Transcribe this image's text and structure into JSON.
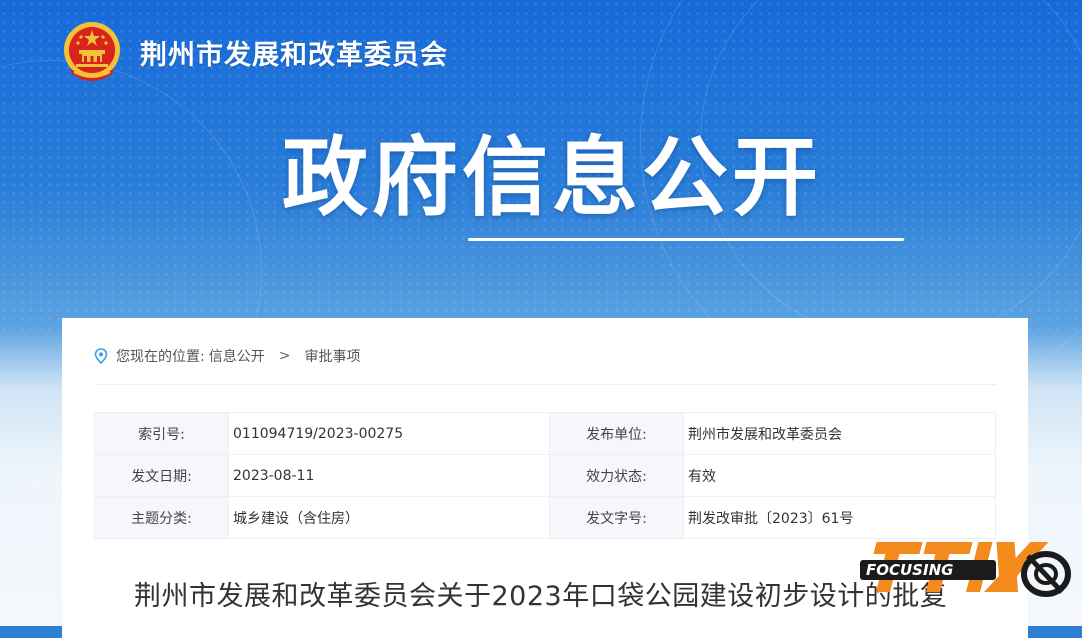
{
  "header": {
    "site_title": "荆州市发展和改革委员会",
    "section_title": "政府信息公开"
  },
  "breadcrumb": {
    "prefix": "您现在的位置:",
    "items": [
      "信息公开",
      "审批事项"
    ],
    "separator": ">"
  },
  "meta": {
    "rows": [
      {
        "label1": "索引号:",
        "value1": "011094719/2023-00275",
        "label2": "发布单位:",
        "value2": "荆州市发展和改革委员会"
      },
      {
        "label1": "发文日期:",
        "value1": "2023-08-11",
        "label2": "效力状态:",
        "value2": "有效"
      },
      {
        "label1": "主题分类:",
        "value1": "城乡建设（含住房）",
        "label2": "发文字号:",
        "value2": "荆发改审批〔2023〕61号"
      }
    ]
  },
  "document": {
    "title": "荆州市发展和改革委员会关于2023年口袋公园建设初步设计的批复"
  },
  "watermark": {
    "text": "FOCUSING"
  },
  "colors": {
    "banner_blue": "#1769d9",
    "pin_icon": "#3aa0e6",
    "emblem_red": "#d8231c",
    "emblem_gold": "#f2c23a"
  }
}
